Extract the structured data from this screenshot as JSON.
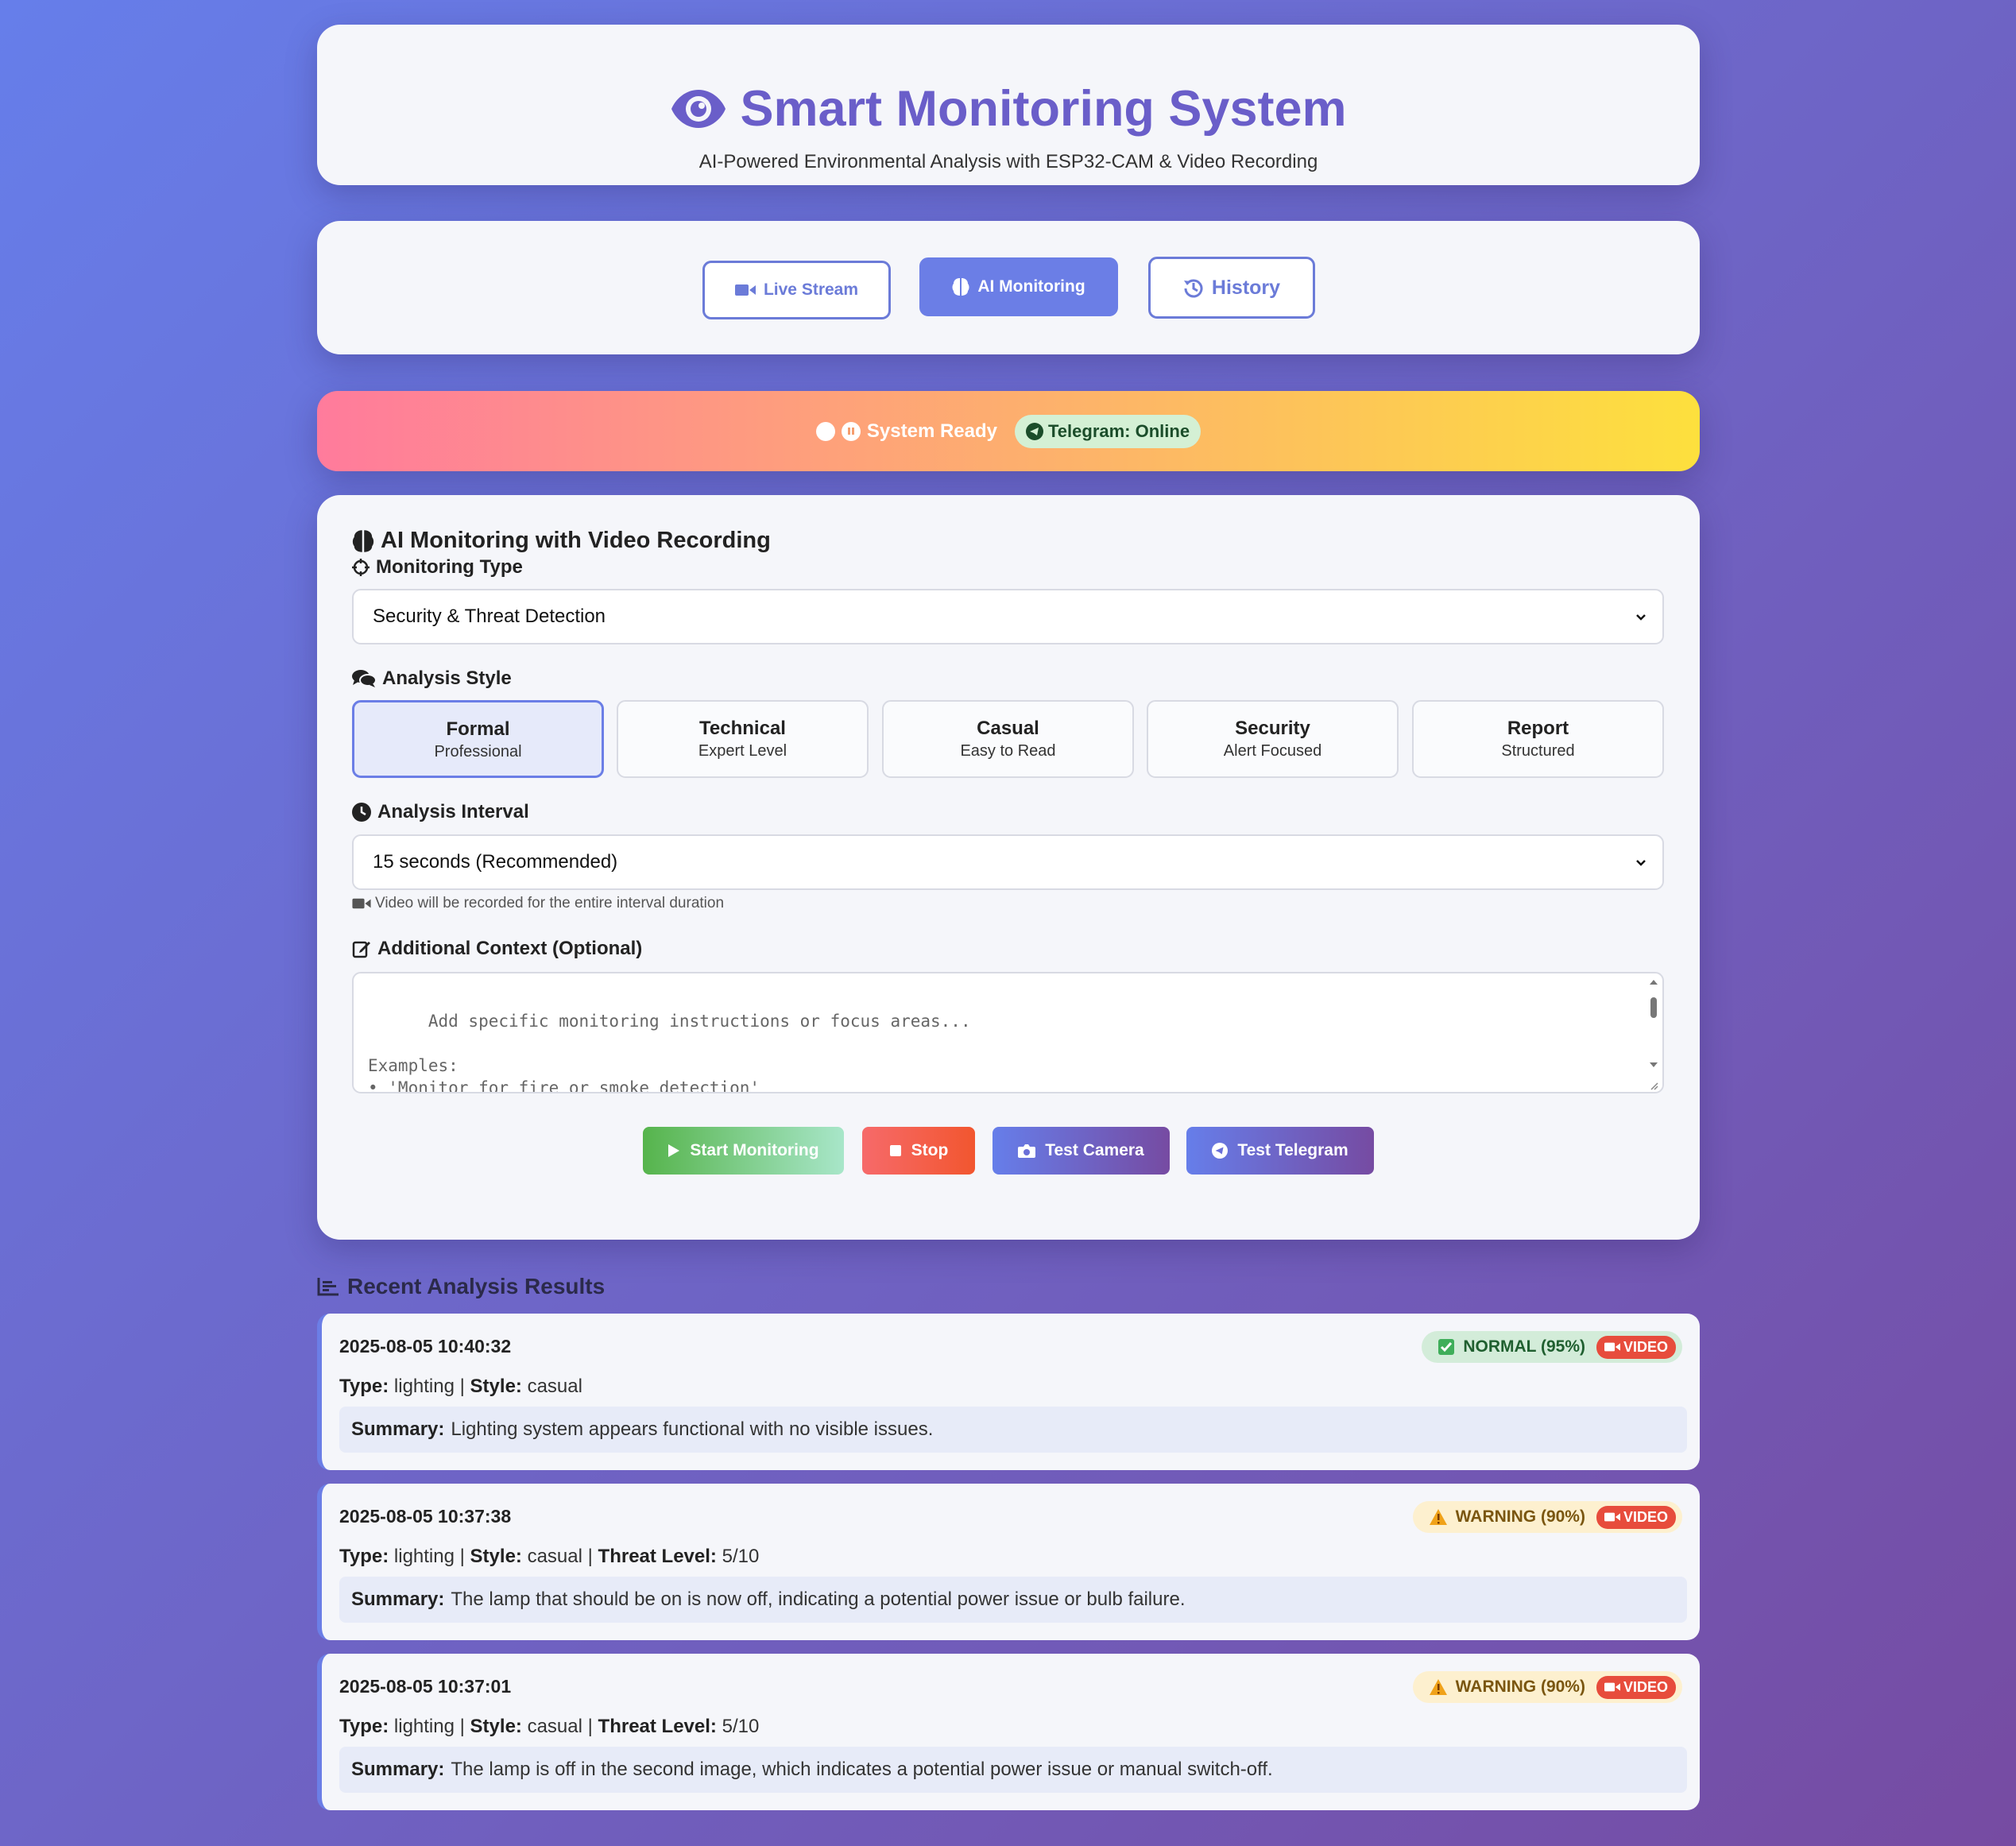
{
  "header": {
    "title": "Smart Monitoring System",
    "subtitle": "AI-Powered Environmental Analysis with ESP32-CAM & Video Recording",
    "icon": "eye-icon"
  },
  "nav": {
    "live_stream": "Live Stream",
    "ai_monitoring": "AI Monitoring",
    "history": "History"
  },
  "status": {
    "text": "System Ready",
    "telegram": "Telegram: Online"
  },
  "main": {
    "title": "AI Monitoring with Video Recording",
    "monitoring_type_label": "Monitoring Type",
    "monitoring_type_value": "Security & Threat Detection",
    "analysis_style_label": "Analysis Style",
    "styles": [
      {
        "name": "Formal",
        "desc": "Professional"
      },
      {
        "name": "Technical",
        "desc": "Expert Level"
      },
      {
        "name": "Casual",
        "desc": "Easy to Read"
      },
      {
        "name": "Security",
        "desc": "Alert Focused"
      },
      {
        "name": "Report",
        "desc": "Structured"
      }
    ],
    "interval_label": "Analysis Interval",
    "interval_value": "15 seconds (Recommended)",
    "interval_note": "Video will be recorded for the entire interval duration",
    "context_label": "Additional Context (Optional)",
    "context_placeholder": "Add specific monitoring instructions or focus areas...\n\nExamples:\n• 'Monitor for fire or smoke detection'\n• 'Check if the printer is working properly'",
    "buttons": {
      "start": "Start Monitoring",
      "stop": "Stop",
      "test_camera": "Test Camera",
      "test_telegram": "Test Telegram"
    }
  },
  "results": {
    "title": "Recent Analysis Results",
    "labels": {
      "type": "Type:",
      "style": "Style:",
      "threat": "Threat Level:",
      "summary": "Summary:",
      "video": "VIDEO"
    },
    "items": [
      {
        "timestamp": "2025-08-05 10:40:32",
        "status": "NORMAL (95%)",
        "type": "lighting",
        "style": "casual",
        "summary": "Lighting system appears functional with no visible issues."
      },
      {
        "timestamp": "2025-08-05 10:37:38",
        "status": "WARNING (90%)",
        "type": "lighting",
        "style": "casual",
        "threat": "5/10",
        "summary": "The lamp that should be on is now off, indicating a potential power issue or bulb failure."
      },
      {
        "timestamp": "2025-08-05 10:37:01",
        "status": "WARNING (90%)",
        "type": "lighting",
        "style": "casual",
        "threat": "5/10",
        "summary": "The lamp is off in the second image, which indicates a potential power issue or manual switch-off."
      }
    ]
  },
  "colors": {
    "accent": "#6b7ee6",
    "title": "#6a5ec9",
    "stop": "#f2562f",
    "start": "#56b44c",
    "video": "#e74c3c"
  }
}
